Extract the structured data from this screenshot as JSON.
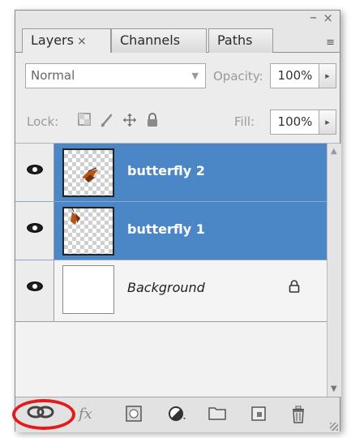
{
  "window": {
    "minimize_glyph": "–",
    "close_glyph": "×"
  },
  "tabs": [
    {
      "label": "Layers",
      "active": true,
      "close_glyph": "×"
    },
    {
      "label": "Channels",
      "active": false
    },
    {
      "label": "Paths",
      "active": false
    }
  ],
  "panel_menu_icon": "≡",
  "blend": {
    "value": "Normal",
    "arrow": "▼"
  },
  "opacity": {
    "label": "Opacity:",
    "value": "100%",
    "arrow": "▸"
  },
  "lock": {
    "label": "Lock:",
    "icons": [
      "lock-transparent-icon",
      "lock-image-brush-icon",
      "lock-position-move-icon",
      "lock-all-padlock-icon"
    ]
  },
  "fill": {
    "label": "Fill:",
    "value": "100%",
    "arrow": "▸"
  },
  "layers": [
    {
      "name": "butterfly 2",
      "selected": true,
      "visible": true,
      "transparent": true
    },
    {
      "name": "butterfly 1",
      "selected": true,
      "visible": true,
      "transparent": true
    },
    {
      "name": "Background",
      "selected": false,
      "visible": true,
      "transparent": false,
      "locked": true
    }
  ],
  "toolbar": {
    "link_glyph": "∞",
    "fx_glyph": "fx",
    "items": [
      "link-layers-icon",
      "fx-icon",
      "layer-mask-icon",
      "adjustment-layer-icon",
      "new-group-icon",
      "new-layer-icon",
      "trash-icon"
    ]
  },
  "colors": {
    "selection": "#4b86c6",
    "highlight_ring": "#e21b1b"
  }
}
